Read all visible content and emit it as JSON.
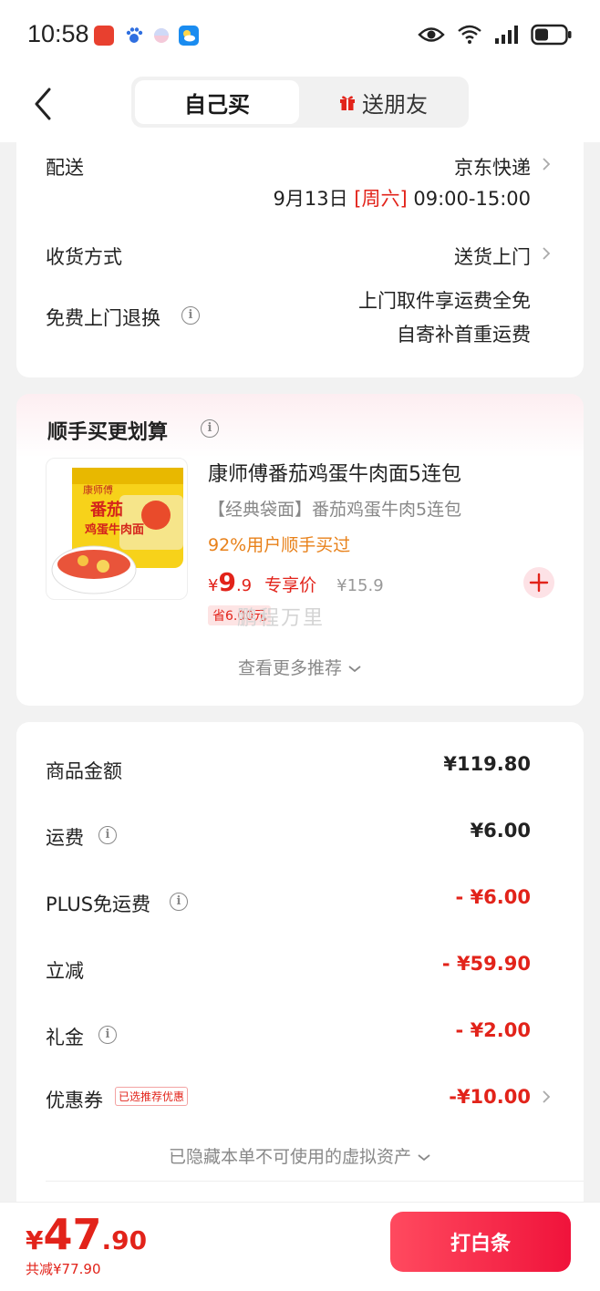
{
  "status_bar": {
    "time": "10:58"
  },
  "nav": {
    "tab_self": "自己买",
    "tab_friend": "送朋友"
  },
  "delivery": {
    "label": "配送",
    "carrier": "京东快递",
    "date": "9月13日",
    "weekday": "[周六]",
    "time_range": "09:00-15:00",
    "receive_label": "收货方式",
    "receive_value": "送货上门",
    "return_label": "免费上门退换",
    "return_line1": "上门取件享运费全免",
    "return_line2": "自寄补首重运费"
  },
  "addon": {
    "title": "顺手买更划算",
    "product_name": "康师傅番茄鸡蛋牛肉面5连包",
    "product_desc": "【经典袋面】番茄鸡蛋牛肉5连包",
    "bought_rate": "92%用户顺手买过",
    "currency": "¥",
    "price_int": "9",
    "price_dec": ".9",
    "price_tag": "专享价",
    "original_price": "¥15.9",
    "save_text": "省6.00元",
    "watermark": "鹏程万里",
    "more_label": "查看更多推荐",
    "img_brand": "康师傅",
    "img_line1": "番茄",
    "img_line2": "鸡蛋牛肉面"
  },
  "summary": {
    "goods_label": "商品金额",
    "goods_value": "¥119.80",
    "freight_label": "运费",
    "freight_value": "¥6.00",
    "plus_label": "PLUS免运费",
    "plus_value": "- ¥6.00",
    "discount_label": "立减",
    "discount_value": "- ¥59.90",
    "gift_label": "礼金",
    "gift_value": "- ¥2.00",
    "coupon_label": "优惠券",
    "coupon_badge": "已选推荐优惠",
    "coupon_value": "-¥10.00",
    "hidden_note": "已隐藏本单不可使用的虚拟资产"
  },
  "footer": {
    "currency": "¥",
    "total_int": "47",
    "total_dec": ".90",
    "saved": "共减¥77.90",
    "pay_button": "打白条"
  },
  "colors": {
    "accent_red": "#e2231a",
    "orange": "#e8811a",
    "pay_gradient_start": "#ff4a5f",
    "pay_gradient_end": "#f0133b"
  }
}
